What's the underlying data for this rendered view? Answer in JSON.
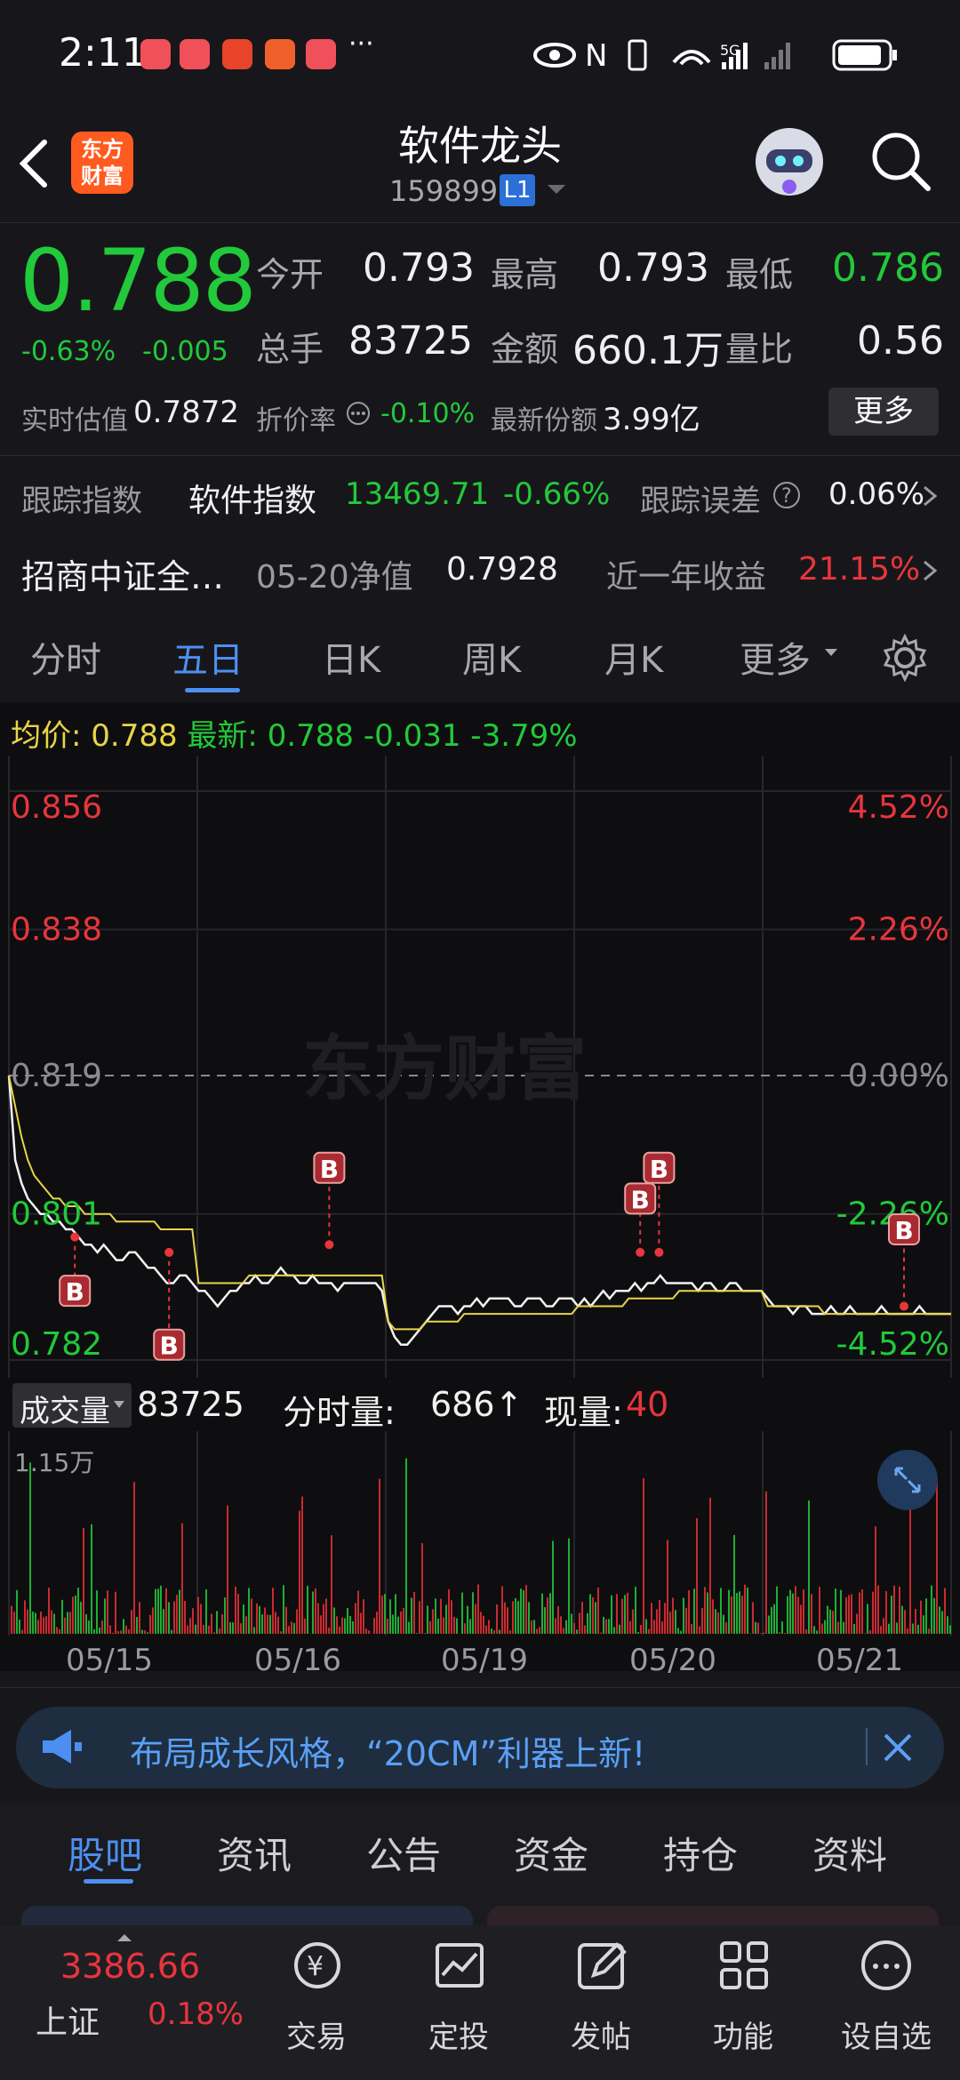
{
  "status_bar": {
    "time": "2:11",
    "dots": "···",
    "network": "5G"
  },
  "header": {
    "title": "软件龙头",
    "code": "159899",
    "level_badge": "L1",
    "logo_text": "东方\n财富"
  },
  "quote": {
    "price": "0.788",
    "change_pct": "-0.63%",
    "change": "-0.005",
    "open_label": "今开",
    "open": "0.793",
    "high_label": "最高",
    "high": "0.793",
    "low_label": "最低",
    "low": "0.786",
    "volume_label": "总手",
    "volume": "83725",
    "amount_label": "金额",
    "amount": "660.1万",
    "vol_ratio_label": "量比",
    "vol_ratio": "0.56",
    "iopv_label": "实时估值",
    "iopv": "0.7872",
    "discount_label": "折价率",
    "discount": "-0.10%",
    "shares_label": "最新份额",
    "shares": "3.99亿",
    "more_button": "更多"
  },
  "tracking": {
    "label": "跟踪指数",
    "index_name": "软件指数",
    "index_value": "13469.71",
    "index_change": "-0.66%",
    "error_label": "跟踪误差",
    "error_value": "0.06%"
  },
  "fund": {
    "name": "招商中证全…",
    "nav_label": "05-20净值",
    "nav": "0.7928",
    "return_label": "近一年收益",
    "return_value": "21.15%"
  },
  "period_tabs": [
    "分时",
    "五日",
    "日K",
    "周K",
    "月K",
    "更多"
  ],
  "chart_info": {
    "avg_label": "均价:",
    "avg": "0.788",
    "latest_label": "最新:",
    "latest": "0.788",
    "change": "-0.031",
    "change_pct": "-3.79%"
  },
  "chart_data": {
    "type": "line",
    "y_left_ticks": [
      "0.856",
      "0.838",
      "0.819",
      "0.801",
      "0.782"
    ],
    "y_right_ticks": [
      "4.52%",
      "2.26%",
      "0.00%",
      "-2.26%",
      "-4.52%"
    ],
    "ylim": [
      0.782,
      0.856
    ],
    "x_labels": [
      "05/15",
      "05/16",
      "05/19",
      "05/20",
      "05/21"
    ],
    "watermark": "东方财富",
    "series": [
      {
        "values": [
          0.819,
          0.808,
          0.805,
          0.803,
          0.802,
          0.801,
          0.801,
          0.8,
          0.8,
          0.799,
          0.799,
          0.798,
          0.797,
          0.797,
          0.796,
          0.797,
          0.796,
          0.795,
          0.795,
          0.796,
          0.796,
          0.795,
          0.794,
          0.794,
          0.793,
          0.792,
          0.792,
          0.793,
          0.793,
          0.792,
          0.791,
          0.791,
          0.79,
          0.789,
          0.79,
          0.791,
          0.791,
          0.792,
          0.792,
          0.793,
          0.792,
          0.792,
          0.793,
          0.794,
          0.793,
          0.793,
          0.792,
          0.792,
          0.793,
          0.792,
          0.792,
          0.792,
          0.791,
          0.792,
          0.792,
          0.792,
          0.792,
          0.792,
          0.792,
          0.791,
          0.787,
          0.785,
          0.784,
          0.784,
          0.785,
          0.786,
          0.787,
          0.788,
          0.789,
          0.789,
          0.789,
          0.788,
          0.789,
          0.789,
          0.79,
          0.789,
          0.79,
          0.79,
          0.79,
          0.79,
          0.789,
          0.789,
          0.79,
          0.79,
          0.79,
          0.789,
          0.789,
          0.79,
          0.79,
          0.79,
          0.789,
          0.79,
          0.789,
          0.79,
          0.791,
          0.79,
          0.791,
          0.791,
          0.791,
          0.792,
          0.791,
          0.792,
          0.792,
          0.793,
          0.792,
          0.792,
          0.792,
          0.792,
          0.792,
          0.791,
          0.792,
          0.792,
          0.791,
          0.791,
          0.792,
          0.792,
          0.791,
          0.791,
          0.791,
          0.791,
          0.79,
          0.789,
          0.789,
          0.789,
          0.788,
          0.789,
          0.789,
          0.788,
          0.788,
          0.788,
          0.789,
          0.788,
          0.788,
          0.789,
          0.788,
          0.788,
          0.788,
          0.788,
          0.789,
          0.788,
          0.788,
          0.788,
          0.788,
          0.788,
          0.789,
          0.788,
          0.788,
          0.788,
          0.788,
          0.788
        ]
      },
      {
        "values": [
          0.819,
          0.815,
          0.811,
          0.808,
          0.806,
          0.805,
          0.804,
          0.803,
          0.803,
          0.802,
          0.802,
          0.802,
          0.801,
          0.801,
          0.801,
          0.801,
          0.801,
          0.8,
          0.8,
          0.8,
          0.8,
          0.8,
          0.8,
          0.8,
          0.799,
          0.799,
          0.799,
          0.799,
          0.799,
          0.799,
          0.792,
          0.792,
          0.792,
          0.792,
          0.792,
          0.792,
          0.792,
          0.792,
          0.793,
          0.793,
          0.793,
          0.793,
          0.793,
          0.793,
          0.793,
          0.793,
          0.793,
          0.793,
          0.793,
          0.793,
          0.793,
          0.793,
          0.793,
          0.793,
          0.793,
          0.793,
          0.793,
          0.793,
          0.793,
          0.793,
          0.787,
          0.786,
          0.786,
          0.786,
          0.786,
          0.786,
          0.787,
          0.787,
          0.787,
          0.787,
          0.787,
          0.787,
          0.788,
          0.788,
          0.788,
          0.788,
          0.788,
          0.788,
          0.788,
          0.788,
          0.788,
          0.788,
          0.788,
          0.788,
          0.788,
          0.788,
          0.788,
          0.788,
          0.788,
          0.788,
          0.789,
          0.789,
          0.789,
          0.789,
          0.789,
          0.789,
          0.789,
          0.789,
          0.79,
          0.79,
          0.79,
          0.79,
          0.79,
          0.79,
          0.79,
          0.79,
          0.791,
          0.791,
          0.791,
          0.791,
          0.791,
          0.791,
          0.791,
          0.791,
          0.791,
          0.791,
          0.791,
          0.791,
          0.791,
          0.791,
          0.789,
          0.789,
          0.789,
          0.789,
          0.789,
          0.789,
          0.789,
          0.789,
          0.789,
          0.788,
          0.788,
          0.788,
          0.788,
          0.788,
          0.788,
          0.788,
          0.788,
          0.788,
          0.788,
          0.788,
          0.788,
          0.788,
          0.788,
          0.788,
          0.788,
          0.788,
          0.788,
          0.788,
          0.788,
          0.788
        ]
      }
    ],
    "markers": [
      "B",
      "B",
      "B",
      "B",
      "B",
      "B"
    ]
  },
  "volume_panel": {
    "label": "成交量",
    "total": "83725",
    "tick_label": "分时量:",
    "tick_value": "686↑",
    "now_label": "现量:",
    "now_value": "40",
    "max_label": "1.15万"
  },
  "banner": {
    "text": "布局成长风格，“20CM”利器上新!"
  },
  "bottom_tabs": [
    "股吧",
    "资讯",
    "公告",
    "资金",
    "持仓",
    "资料"
  ],
  "bottom_nav": {
    "index_value": "3386.66",
    "index_name": "上证",
    "index_change": "0.18%",
    "items": [
      "交易",
      "定投",
      "发帖",
      "功能",
      "设自选"
    ]
  },
  "colors": {
    "up": "#e8353d",
    "down": "#22c93a",
    "accent": "#4d8ff0",
    "avg_line": "#e8d44a"
  }
}
